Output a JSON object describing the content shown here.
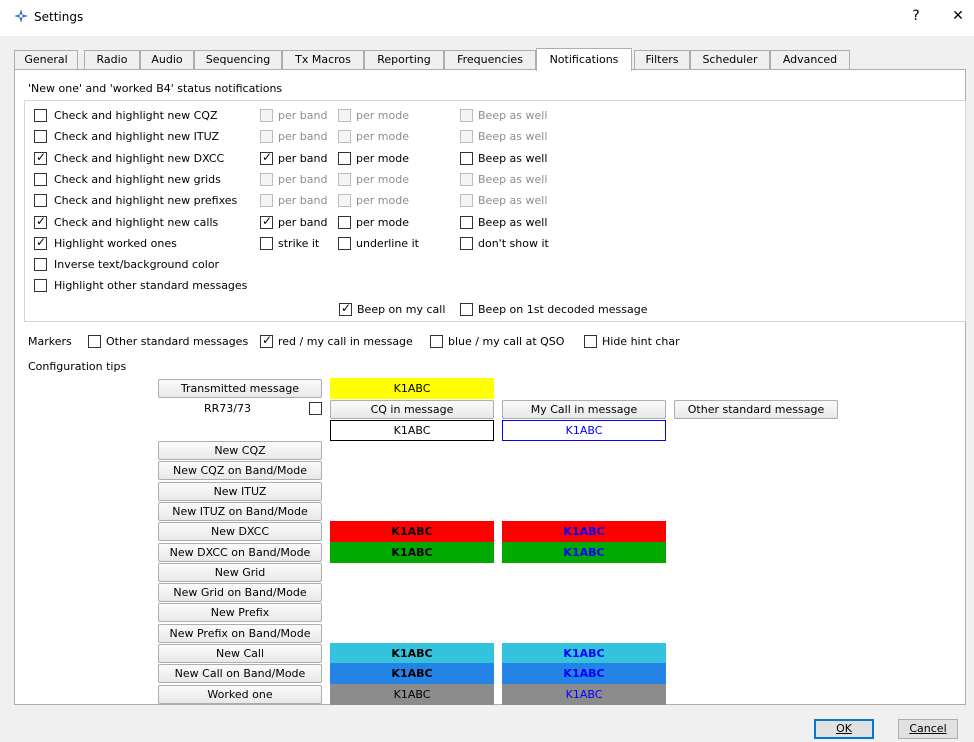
{
  "window": {
    "title": "Settings",
    "help_glyph": "?",
    "close_glyph": "✕"
  },
  "tabs": [
    {
      "label": "General"
    },
    {
      "label": "Radio"
    },
    {
      "label": "Audio"
    },
    {
      "label": "Sequencing"
    },
    {
      "label": "Tx Macros"
    },
    {
      "label": "Reporting"
    },
    {
      "label": "Frequencies"
    },
    {
      "label": "Notifications",
      "active": true
    },
    {
      "label": "Filters"
    },
    {
      "label": "Scheduler"
    },
    {
      "label": "Advanced"
    }
  ],
  "status_group": {
    "title": "'New one' and 'worked B4' status notifications",
    "rows": [
      {
        "label": "Check and highlight new CQZ",
        "checked": false,
        "c2": "per band",
        "c2_checked": false,
        "c3": "per mode",
        "c3_checked": false,
        "c4": "Beep as well",
        "c4_checked": false,
        "extras_enabled": false
      },
      {
        "label": "Check and highlight new ITUZ",
        "checked": false,
        "c2": "per band",
        "c2_checked": false,
        "c3": "per mode",
        "c3_checked": false,
        "c4": "Beep as well",
        "c4_checked": false,
        "extras_enabled": false
      },
      {
        "label": "Check and highlight new DXCC",
        "checked": true,
        "c2": "per band",
        "c2_checked": true,
        "c3": "per mode",
        "c3_checked": false,
        "c4": "Beep as well",
        "c4_checked": false,
        "extras_enabled": true
      },
      {
        "label": "Check and highlight new grids",
        "checked": false,
        "c2": "per band",
        "c2_checked": false,
        "c3": "per mode",
        "c3_checked": false,
        "c4": "Beep as well",
        "c4_checked": false,
        "extras_enabled": false
      },
      {
        "label": "Check and highlight new prefixes",
        "checked": false,
        "c2": "per band",
        "c2_checked": false,
        "c3": "per mode",
        "c3_checked": false,
        "c4": "Beep as well",
        "c4_checked": false,
        "extras_enabled": false
      },
      {
        "label": "Check and highlight new calls",
        "checked": true,
        "c2": "per band",
        "c2_checked": true,
        "c3": "per mode",
        "c3_checked": false,
        "c4": "Beep as well",
        "c4_checked": false,
        "extras_enabled": true
      },
      {
        "label": "Highlight worked ones",
        "checked": true,
        "c2": "strike it",
        "c2_checked": false,
        "c3": "underline it",
        "c3_checked": false,
        "c4": "don't show it",
        "c4_checked": false,
        "extras_enabled": true
      },
      {
        "label": "Inverse text/background color",
        "checked": false
      },
      {
        "label": "Highlight other standard messages",
        "checked": false
      }
    ],
    "beep_my_call": {
      "label": "Beep on my call",
      "checked": true
    },
    "beep_first": {
      "label": "Beep on 1st decoded message",
      "checked": false
    }
  },
  "markers": {
    "label": "Markers",
    "items": [
      {
        "label": "Other standard messages",
        "checked": false
      },
      {
        "label": "red / my call in message",
        "checked": true
      },
      {
        "label": "blue / my call at QSO",
        "checked": false
      },
      {
        "label": "Hide hint char",
        "checked": false
      }
    ]
  },
  "config_tips": {
    "label": "Configuration tips",
    "transmitted_button": "Transmitted message",
    "rr73_label": "RR73/73",
    "rr73_checked": false,
    "cq_button": "CQ in message",
    "mycall_button": "My Call in message",
    "other_button": "Other standard message",
    "sample_call": "K1ABC",
    "rows": [
      {
        "button": "New CQZ"
      },
      {
        "button": "New CQZ on Band/Mode"
      },
      {
        "button": "New ITUZ"
      },
      {
        "button": "New ITUZ on Band/Mode"
      },
      {
        "button": "New DXCC",
        "cq_bg": "#ff0000",
        "cq_fg": "#000000",
        "my_bg": "#ff0000",
        "my_fg": "#0000ff",
        "bold": true
      },
      {
        "button": "New DXCC on Band/Mode",
        "cq_bg": "#00aa00",
        "cq_fg": "#000000",
        "my_bg": "#00aa00",
        "my_fg": "#0000ff",
        "bold": true
      },
      {
        "button": "New Grid"
      },
      {
        "button": "New Grid on Band/Mode"
      },
      {
        "button": "New Prefix"
      },
      {
        "button": "New Prefix on Band/Mode"
      },
      {
        "button": "New Call",
        "cq_bg": "#33c3dc",
        "cq_fg": "#000000",
        "my_bg": "#33c3dc",
        "my_fg": "#0000ff",
        "bold": true
      },
      {
        "button": "New Call on Band/Mode",
        "cq_bg": "#2384e6",
        "cq_fg": "#000000",
        "my_bg": "#2384e6",
        "my_fg": "#0000ff",
        "bold": true
      },
      {
        "button": "Worked one",
        "cq_bg": "#8c8c8c",
        "cq_fg": "#000000",
        "my_bg": "#8c8c8c",
        "my_fg": "#0000ff",
        "bold": false
      }
    ],
    "transmitted_bg": "#ffff00"
  },
  "dialog": {
    "ok": "OK",
    "cancel": "Cancel"
  },
  "colors": {
    "accent": "#0078d7",
    "app_icon": "#2a6cd6"
  }
}
